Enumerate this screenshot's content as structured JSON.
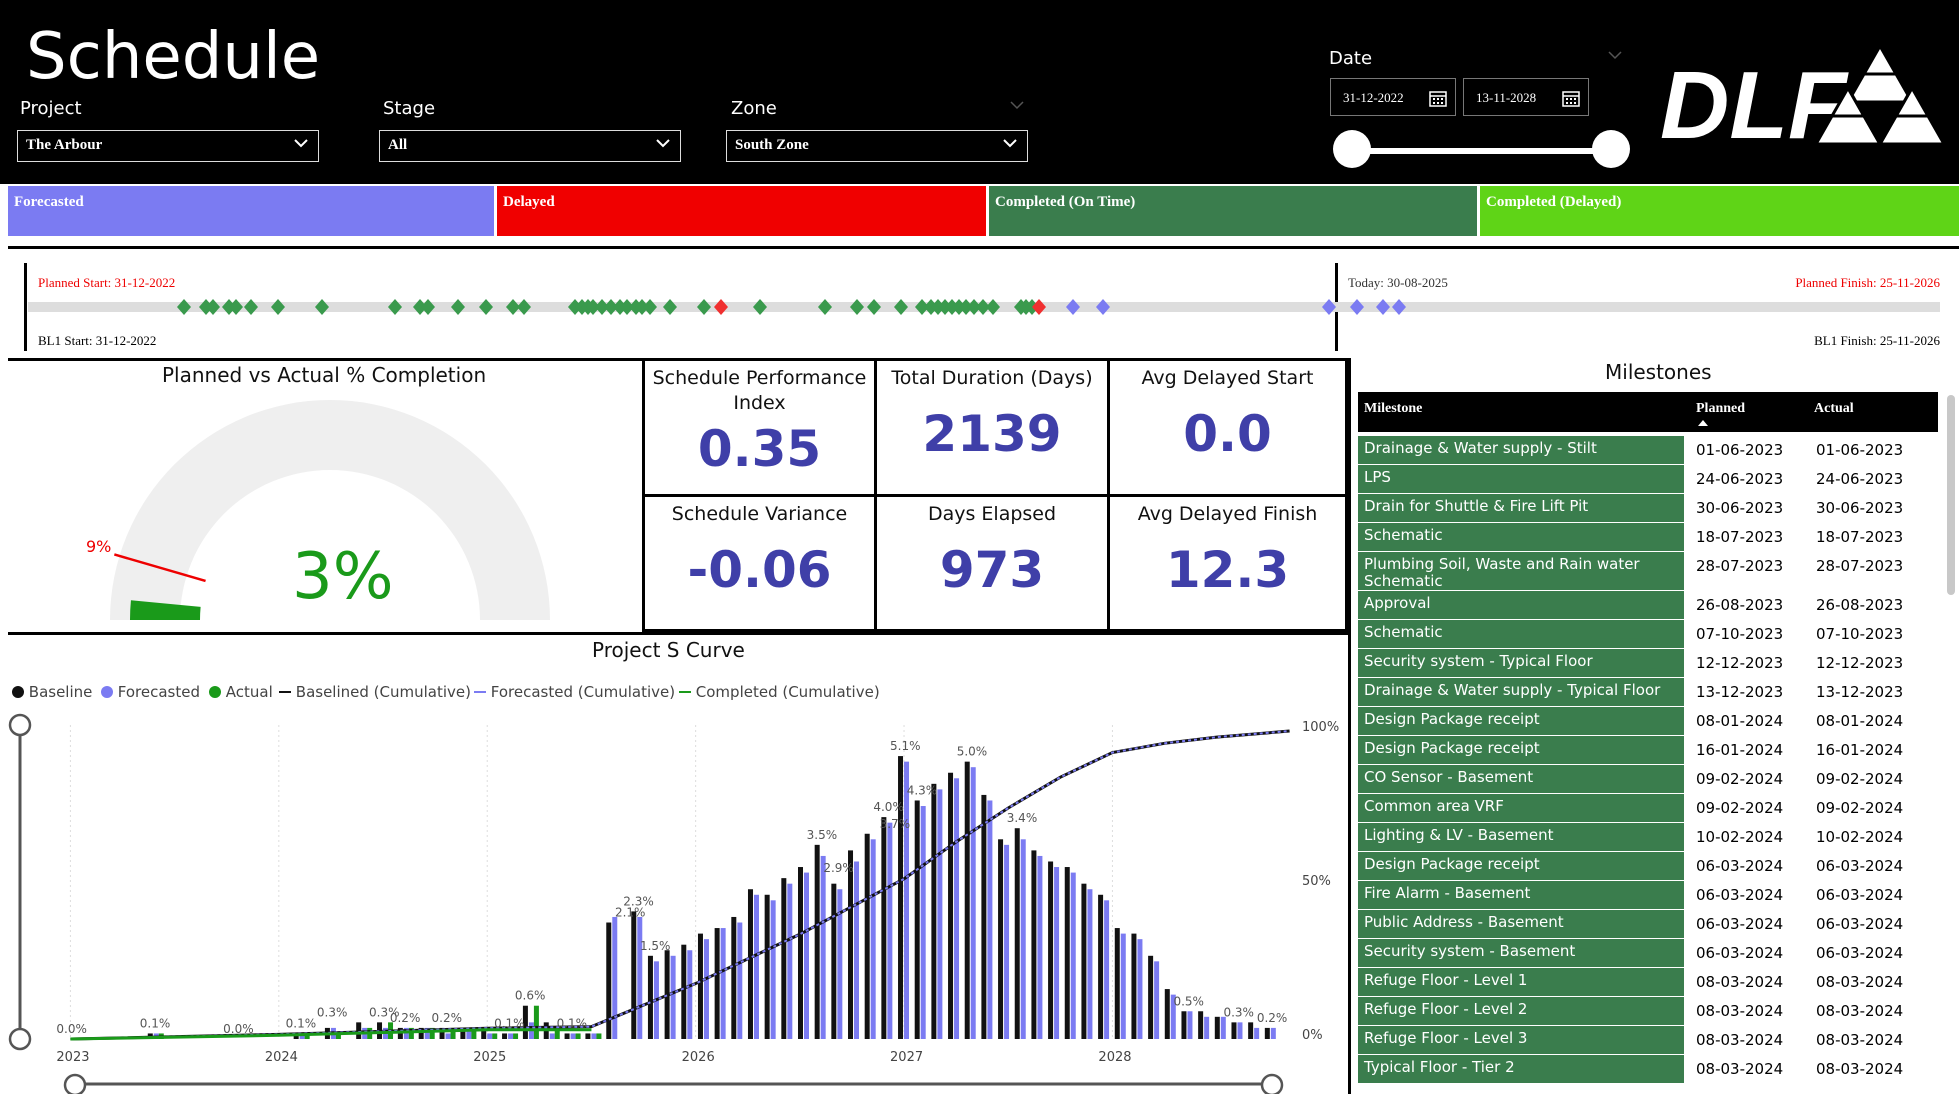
{
  "header": {
    "title": "Schedule",
    "project_label": "Project",
    "project_value": "The Arbour",
    "stage_label": "Stage",
    "stage_value": "All",
    "zone_label": "Zone",
    "zone_value": "South Zone",
    "date_label": "Date",
    "date_start": "31-12-2022",
    "date_end": "13-11-2028",
    "logo_text": "DLF"
  },
  "legend_band": [
    {
      "label": "Forecasted",
      "color": "#7b7bf2"
    },
    {
      "label": "Delayed",
      "color": "#f00000"
    },
    {
      "label": "Completed (On Time)",
      "color": "#3a7d4d"
    },
    {
      "label": "Completed (Delayed)",
      "color": "#5fd417"
    }
  ],
  "timeline": {
    "planned_start": "Planned Start: 31-12-2022",
    "bl1_start": "BL1 Start: 31-12-2022",
    "today": "Today: 30-08-2025",
    "planned_finish": "Planned Finish: 25-11-2026",
    "bl1_finish": "BL1 Finish: 25-11-2026"
  },
  "gauge": {
    "title": "Planned vs Actual % Completion",
    "actual_label": "3%",
    "planned_label": "9%",
    "actual_value": 3,
    "planned_value": 9
  },
  "kpis": [
    {
      "label": "Schedule Performance Index",
      "value": "0.35"
    },
    {
      "label": "Total Duration (Days)",
      "value": "2139"
    },
    {
      "label": "Avg Delayed Start",
      "value": "0.0"
    },
    {
      "label": "Schedule Variance",
      "value": "-0.06"
    },
    {
      "label": "Days Elapsed",
      "value": "973"
    },
    {
      "label": "Avg Delayed Finish",
      "value": "12.3"
    }
  ],
  "milestones": {
    "title": "Milestones",
    "columns": [
      "Milestone",
      "Planned",
      "Actual"
    ],
    "rows": [
      [
        "Drainage & Water supply - Stilt",
        "01-06-2023",
        "01-06-2023"
      ],
      [
        "LPS",
        "24-06-2023",
        "24-06-2023"
      ],
      [
        "Drain for Shuttle & Fire Lift Pit",
        "30-06-2023",
        "30-06-2023"
      ],
      [
        "Schematic",
        "18-07-2023",
        "18-07-2023"
      ],
      [
        "Plumbing Soil, Waste and Rain water Schematic",
        "28-07-2023",
        "28-07-2023"
      ],
      [
        "Approval",
        "26-08-2023",
        "26-08-2023"
      ],
      [
        "Schematic",
        "07-10-2023",
        "07-10-2023"
      ],
      [
        "Security system - Typical Floor",
        "12-12-2023",
        "12-12-2023"
      ],
      [
        "Drainage & Water supply - Typical Floor",
        "13-12-2023",
        "13-12-2023"
      ],
      [
        "Design Package receipt",
        "08-01-2024",
        "08-01-2024"
      ],
      [
        "Design Package receipt",
        "16-01-2024",
        "16-01-2024"
      ],
      [
        "CO Sensor - Basement",
        "09-02-2024",
        "09-02-2024"
      ],
      [
        "Common area VRF",
        "09-02-2024",
        "09-02-2024"
      ],
      [
        "Lighting & LV - Basement",
        "10-02-2024",
        "10-02-2024"
      ],
      [
        "Design Package receipt",
        "06-03-2024",
        "06-03-2024"
      ],
      [
        "Fire Alarm - Basement",
        "06-03-2024",
        "06-03-2024"
      ],
      [
        "Public Address - Basement",
        "06-03-2024",
        "06-03-2024"
      ],
      [
        "Security system - Basement",
        "06-03-2024",
        "06-03-2024"
      ],
      [
        "Refuge Floor - Level 1",
        "08-03-2024",
        "08-03-2024"
      ],
      [
        "Refuge Floor - Level 2",
        "08-03-2024",
        "08-03-2024"
      ],
      [
        "Refuge Floor - Level 3",
        "08-03-2024",
        "08-03-2024"
      ],
      [
        "Typical Floor - Tier 2",
        "08-03-2024",
        "08-03-2024"
      ]
    ]
  },
  "chart_data": {
    "type": "bar",
    "title": "Project S Curve",
    "legend": [
      "Baseline",
      "Forecasted",
      "Actual",
      "Baselined (Cumulative)",
      "Forecasted (Cumulative)",
      "Completed (Cumulative)"
    ],
    "x_ticks": [
      "2023",
      "2024",
      "2025",
      "2026",
      "2027",
      "2028"
    ],
    "y2_ticks": [
      "100%",
      "50%",
      "0%"
    ],
    "colors": {
      "baseline": "#111111",
      "forecasted": "#7b7bf2",
      "actual": "#1a9a1a",
      "cum_baseline": "#111111",
      "cum_forecast": "#7b7bf2",
      "cum_actual": "#1a9a1a"
    },
    "bar_x": [
      2023.0,
      2023.4,
      2023.8,
      2024.1,
      2024.25,
      2024.4,
      2024.5,
      2024.6,
      2024.7,
      2024.8,
      2024.9,
      2025.0,
      2025.1,
      2025.2,
      2025.3,
      2025.4,
      2025.5,
      2025.6,
      2025.72,
      2025.8,
      2025.88,
      2025.96,
      2026.04,
      2026.12,
      2026.2,
      2026.28,
      2026.36,
      2026.44,
      2026.52,
      2026.6,
      2026.68,
      2026.76,
      2026.84,
      2026.92,
      2027.0,
      2027.08,
      2027.16,
      2027.24,
      2027.32,
      2027.4,
      2027.48,
      2027.56,
      2027.64,
      2027.72,
      2027.8,
      2027.88,
      2027.96,
      2028.04,
      2028.12,
      2028.2,
      2028.28,
      2028.36,
      2028.44,
      2028.52,
      2028.6,
      2028.68,
      2028.76
    ],
    "baseline": [
      0.0,
      0.1,
      0.0,
      0.1,
      0.2,
      0.3,
      0.3,
      0.2,
      0.2,
      0.2,
      0.2,
      0.2,
      0.1,
      0.6,
      0.3,
      0.1,
      0.1,
      2.1,
      2.3,
      1.5,
      1.6,
      1.7,
      1.9,
      2.0,
      2.2,
      2.7,
      2.6,
      2.9,
      3.1,
      3.5,
      2.8,
      3.4,
      3.7,
      4.0,
      5.1,
      4.3,
      4.6,
      4.8,
      5.0,
      4.4,
      3.6,
      3.8,
      3.4,
      3.2,
      3.1,
      2.8,
      2.6,
      2.0,
      1.9,
      1.5,
      0.9,
      0.5,
      0.5,
      0.4,
      0.3,
      0.3,
      0.2
    ],
    "forecasted": [
      0.0,
      0.1,
      0.0,
      0.1,
      0.2,
      0.2,
      0.2,
      0.2,
      0.2,
      0.1,
      0.2,
      0.1,
      0.1,
      0.3,
      0.1,
      0.1,
      0.1,
      2.2,
      2.2,
      1.4,
      1.5,
      1.6,
      1.8,
      2.0,
      2.1,
      2.6,
      2.5,
      2.8,
      3.0,
      3.3,
      2.7,
      3.2,
      3.6,
      3.9,
      5.0,
      4.2,
      4.5,
      4.7,
      4.9,
      4.3,
      3.5,
      3.6,
      3.3,
      3.1,
      3.0,
      2.7,
      2.5,
      1.9,
      1.8,
      1.4,
      0.8,
      0.5,
      0.4,
      0.4,
      0.3,
      0.2,
      0.2
    ],
    "actual": [
      0.0,
      0.1,
      0.0,
      0.1,
      0.1,
      0.2,
      0.3,
      0.2,
      0.2,
      0.2,
      0.2,
      0.1,
      0.1,
      0.6,
      0.2,
      0.1,
      0.1,
      0,
      0,
      0,
      0,
      0,
      0,
      0,
      0,
      0,
      0,
      0,
      0,
      0,
      0,
      0,
      0,
      0,
      0,
      0,
      0,
      0,
      0,
      0,
      0,
      0,
      0,
      0,
      0,
      0,
      0,
      0,
      0,
      0,
      0,
      0,
      0,
      0,
      0,
      0,
      0
    ],
    "data_labels": [
      {
        "x": 2023.0,
        "text": "0.0%"
      },
      {
        "x": 2023.4,
        "text": "0.1%"
      },
      {
        "x": 2023.8,
        "text": "0.0%"
      },
      {
        "x": 2024.1,
        "text": "0.1%"
      },
      {
        "x": 2024.25,
        "text": "0.3%"
      },
      {
        "x": 2024.5,
        "text": "0.3%"
      },
      {
        "x": 2024.6,
        "text": "0.2%"
      },
      {
        "x": 2024.8,
        "text": "0.2%"
      },
      {
        "x": 2025.1,
        "text": "0.1%"
      },
      {
        "x": 2025.2,
        "text": "0.6%"
      },
      {
        "x": 2025.4,
        "text": "0.1%"
      },
      {
        "x": 2025.72,
        "text": "2.3%"
      },
      {
        "x": 2025.68,
        "text": "2.1%"
      },
      {
        "x": 2025.8,
        "text": "1.5%"
      },
      {
        "x": 2026.6,
        "text": "3.5%"
      },
      {
        "x": 2026.68,
        "text": "2.9%"
      },
      {
        "x": 2026.92,
        "text": "4.0%"
      },
      {
        "x": 2026.95,
        "text": "3.7%"
      },
      {
        "x": 2027.0,
        "text": "5.1%"
      },
      {
        "x": 2027.08,
        "text": "4.3%"
      },
      {
        "x": 2027.32,
        "text": "5.0%"
      },
      {
        "x": 2027.56,
        "text": "3.4%"
      },
      {
        "x": 2028.36,
        "text": "0.5%"
      },
      {
        "x": 2028.6,
        "text": "0.3%"
      },
      {
        "x": 2028.76,
        "text": "0.2%"
      }
    ],
    "cumulative_x": [
      2023.0,
      2024.0,
      2025.0,
      2025.5,
      2026.0,
      2026.5,
      2027.0,
      2027.25,
      2027.5,
      2027.75,
      2028.0,
      2028.25,
      2028.5,
      2028.85
    ],
    "cumulative_baseline": [
      0,
      1.5,
      3.5,
      4,
      18,
      34,
      52,
      64,
      75,
      85,
      93,
      96,
      98,
      100
    ],
    "cumulative_forecast": [
      0,
      1.5,
      3.5,
      4,
      18,
      34,
      52,
      64,
      75,
      85,
      93,
      96,
      98,
      100
    ],
    "cumulative_actual_x": [
      2023.0,
      2024.0,
      2025.0,
      2025.5
    ],
    "cumulative_actual": [
      0,
      1.2,
      3.0,
      3.0
    ],
    "y2lim": [
      0,
      100
    ]
  }
}
